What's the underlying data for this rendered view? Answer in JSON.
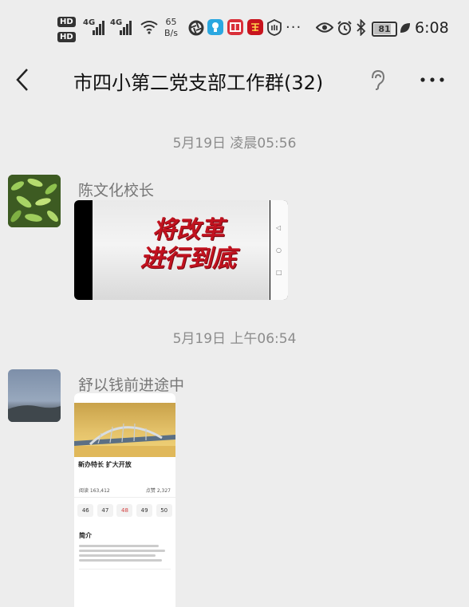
{
  "status_bar": {
    "hd1": "HD",
    "hd2": "HD",
    "signal1": "4G",
    "signal2": "4G",
    "net_speed": "65",
    "net_unit": "B/s",
    "more": "···",
    "battery": "81",
    "battery_level": 0.81,
    "time": "6:08"
  },
  "header": {
    "title": "市四小第二党支部工作群(32)"
  },
  "messages": [
    {
      "timestamp": "5月19日 凌晨05:56",
      "sender": "陈文化校长",
      "type": "video",
      "video_text_line1": "将改革",
      "video_text_line2": "进行到底"
    },
    {
      "timestamp": "5月19日 上午06:54",
      "sender": "舒以钱前进途中",
      "type": "image",
      "headline": "新办特长 扩大开放",
      "stat_a": "阅读 163,412",
      "stat_b": "点赞 2,327",
      "numbers": [
        "46",
        "47",
        "48",
        "49",
        "50"
      ],
      "section": "简介"
    }
  ],
  "colors": {
    "background": "#ededed",
    "timestamp": "#8c8c8c",
    "sender": "#777777",
    "video_text": "#c1121f"
  }
}
